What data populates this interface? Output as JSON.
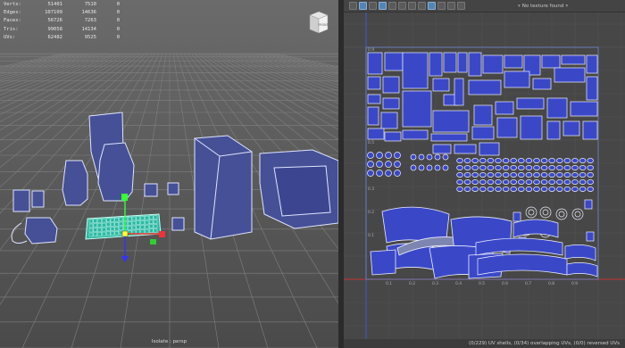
{
  "stats": [
    {
      "label": "Verts:",
      "a": "51401",
      "b": "7510",
      "c": "0"
    },
    {
      "label": "Edges:",
      "a": "107109",
      "b": "14636",
      "c": "0"
    },
    {
      "label": "Faces:",
      "a": "56726",
      "b": "7263",
      "c": "0"
    },
    {
      "label": "Tris:",
      "a": "99058",
      "b": "14134",
      "c": "0"
    },
    {
      "label": "UVs:",
      "a": "62482",
      "b": "9525",
      "c": "0"
    }
  ],
  "viewcube_label": "FRONT",
  "camera_label": "Isolate : persp",
  "uv_editor": {
    "texture_label": "No texture found",
    "tick_labels": [
      "0.9",
      "0.8",
      "0.7",
      "0.6",
      "0.5",
      "0.4",
      "0.3",
      "0.2",
      "0.1"
    ],
    "bottom_ticks": [
      "0.1",
      "0.2",
      "0.3",
      "0.4",
      "0.5",
      "0.6",
      "0.7",
      "0.8",
      "0.9"
    ],
    "status": "(0/229) UV shells, (0/34) overlapping UVs, (0/0) reversed UVs"
  },
  "colors": {
    "uv_blue": "#3a48c8",
    "uv_line": "#e8e8f0",
    "axis_red": "#c83232",
    "axis_blue": "#3c5ad2"
  }
}
